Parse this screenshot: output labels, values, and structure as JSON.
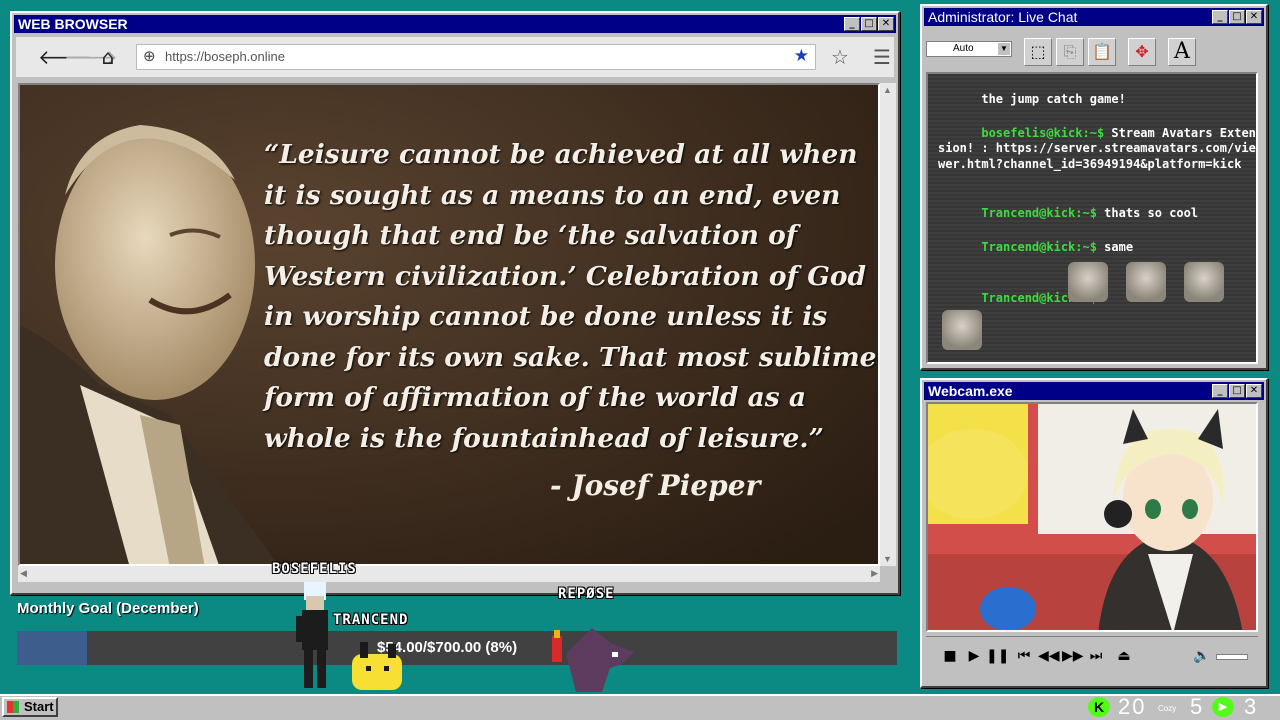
{
  "browser": {
    "title": "WEB BROWSER",
    "url": "https://boseph.online",
    "quote": "“Leisure cannot be achieved at all when it is sought as a means to an end, even though that end be ‘the salvation of Western civilization.’ Celebration of God in worship cannot be done unless it is done for its own sake. That most sublime form of affirmation of the world as a whole is the fountainhead of leisure.”",
    "author": "- Josef Pieper"
  },
  "chat": {
    "title": "Administrator: Live Chat",
    "font_size_value": "Auto",
    "messages": [
      {
        "user": "",
        "text": "the jump catch game!"
      },
      {
        "user": "bosefelis@kick:~$",
        "text": " Stream Avatars Extension! : https://server.streamavatars.com/viewer.html?channel_id=36949194&platform=kick"
      },
      {
        "user": "Trancend@kick:~$",
        "text": " thats so cool"
      },
      {
        "user": "Trancend@kick:~$",
        "text": " same"
      },
      {
        "user": "Trancend@kick:~$",
        "text": ""
      }
    ],
    "tool_a": "A"
  },
  "webcam": {
    "title": "Webcam.exe"
  },
  "goal": {
    "label": "Monthly Goal (December)",
    "amount_text": "$54.00/$700.00 (8%)",
    "progress": 0.08
  },
  "avatars": {
    "a1": "BOSEFELIS",
    "a2": "TRANCEND",
    "a3": "REPØSE"
  },
  "taskbar": {
    "start_label": "Start",
    "count1": "20",
    "count1_caption": "Cozy",
    "count2": "5",
    "count3": "3"
  },
  "colors": {
    "desktop": "#0a8a82",
    "titlebar": "#000086",
    "chat_user": "#3ddc3d",
    "goal_fill": "#3d5d8c",
    "kick_green": "#53fc18"
  }
}
